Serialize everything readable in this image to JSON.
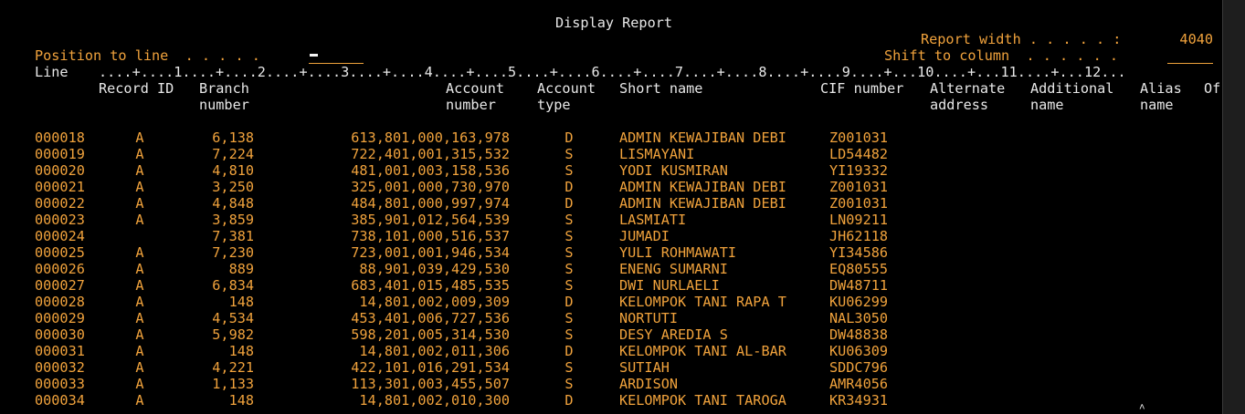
{
  "screen": {
    "title": "Display Report",
    "report_width_label": "Report width . . . . . :",
    "report_width_value": "4040",
    "position_label": "Position to line  . . . . .",
    "position_value": "",
    "shift_label": "Shift to column  . . . . . .",
    "shift_value": "",
    "ruler_label": "Line",
    "ruler": "....+....1....+....2....+....3....+....4....+....5....+....6....+....7....+....8....+....9....+...10....+...11....+...12..."
  },
  "columns": [
    {
      "line1": "Record ID",
      "line2": ""
    },
    {
      "line1": "Branch",
      "line2": "number"
    },
    {
      "line1": "Account",
      "line2": "number"
    },
    {
      "line1": "Account",
      "line2": "type"
    },
    {
      "line1": "Short name",
      "line2": ""
    },
    {
      "line1": "CIF number",
      "line2": ""
    },
    {
      "line1": "Alternate",
      "line2": "address"
    },
    {
      "line1": "Additional",
      "line2": "name"
    },
    {
      "line1": "Alias",
      "line2": "name"
    },
    {
      "line1": "Of",
      "line2": ""
    }
  ],
  "rows": [
    {
      "line": "000018",
      "record_id": "A",
      "branch": "6,138",
      "account": "613,801,000,163,978",
      "type": "D",
      "short_name": "ADMIN KEWAJIBAN DEBI",
      "cif": "Z001031"
    },
    {
      "line": "000019",
      "record_id": "A",
      "branch": "7,224",
      "account": "722,401,001,315,532",
      "type": "S",
      "short_name": "LISMAYANI",
      "cif": "LD54482"
    },
    {
      "line": "000020",
      "record_id": "A",
      "branch": "4,810",
      "account": "481,001,003,158,536",
      "type": "S",
      "short_name": "YODI KUSMIRAN",
      "cif": "YI19332"
    },
    {
      "line": "000021",
      "record_id": "A",
      "branch": "3,250",
      "account": "325,001,000,730,970",
      "type": "D",
      "short_name": "ADMIN KEWAJIBAN DEBI",
      "cif": "Z001031"
    },
    {
      "line": "000022",
      "record_id": "A",
      "branch": "4,848",
      "account": "484,801,000,997,974",
      "type": "D",
      "short_name": "ADMIN KEWAJIBAN DEBI",
      "cif": "Z001031"
    },
    {
      "line": "000023",
      "record_id": "A",
      "branch": "3,859",
      "account": "385,901,012,564,539",
      "type": "S",
      "short_name": "LASMIATI",
      "cif": "LN09211"
    },
    {
      "line": "000024",
      "record_id": "",
      "branch": "7,381",
      "account": "738,101,000,516,537",
      "type": "S",
      "short_name": "JUMADI",
      "cif": "JH62118"
    },
    {
      "line": "000025",
      "record_id": "A",
      "branch": "7,230",
      "account": "723,001,001,946,534",
      "type": "S",
      "short_name": "YULI ROHMAWATI",
      "cif": "YI34586"
    },
    {
      "line": "000026",
      "record_id": "A",
      "branch": "889",
      "account": "88,901,039,429,530",
      "type": "S",
      "short_name": "ENENG SUMARNI",
      "cif": "EQ80555"
    },
    {
      "line": "000027",
      "record_id": "A",
      "branch": "6,834",
      "account": "683,401,015,485,535",
      "type": "S",
      "short_name": "DWI NURLAELI",
      "cif": "DW48711"
    },
    {
      "line": "000028",
      "record_id": "A",
      "branch": "148",
      "account": "14,801,002,009,309",
      "type": "D",
      "short_name": "KELOMPOK TANI RAPA T",
      "cif": "KU06299"
    },
    {
      "line": "000029",
      "record_id": "A",
      "branch": "4,534",
      "account": "453,401,006,727,536",
      "type": "S",
      "short_name": "NORTUTI",
      "cif": "NAL3050"
    },
    {
      "line": "000030",
      "record_id": "A",
      "branch": "5,982",
      "account": "598,201,005,314,530",
      "type": "S",
      "short_name": "DESY AREDIA S",
      "cif": "DW48838"
    },
    {
      "line": "000031",
      "record_id": "A",
      "branch": "148",
      "account": "14,801,002,011,306",
      "type": "D",
      "short_name": "KELOMPOK TANI AL-BAR",
      "cif": "KU06309"
    },
    {
      "line": "000032",
      "record_id": "A",
      "branch": "4,221",
      "account": "422,101,016,291,534",
      "type": "S",
      "short_name": "SUTIAH",
      "cif": "SDDC796"
    },
    {
      "line": "000033",
      "record_id": "A",
      "branch": "1,133",
      "account": "113,301,003,455,507",
      "type": "S",
      "short_name": "ARDISON",
      "cif": "AMR4056"
    },
    {
      "line": "000034",
      "record_id": "A",
      "branch": "148",
      "account": "14,801,002,010,300",
      "type": "D",
      "short_name": "KELOMPOK TANI TAROGA",
      "cif": "KR34931"
    }
  ]
}
